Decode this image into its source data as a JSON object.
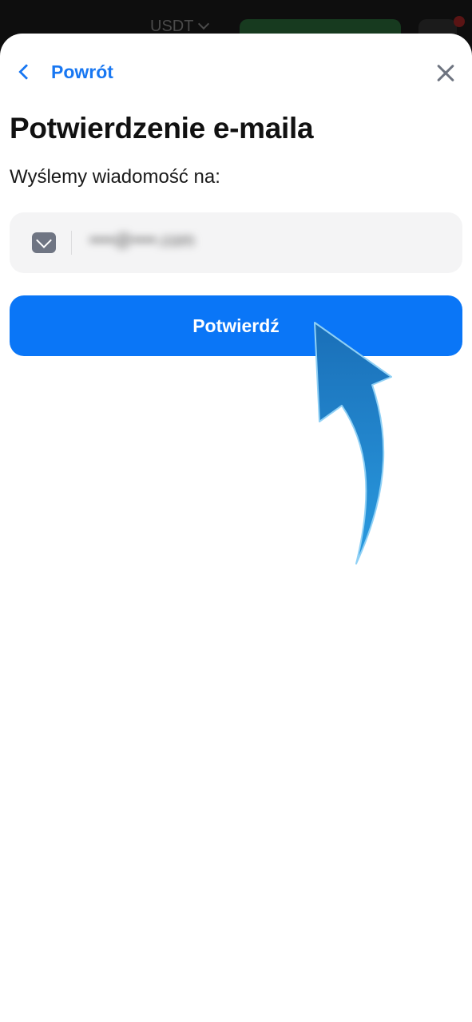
{
  "background_bar": {
    "logo": "",
    "currency": "USDT"
  },
  "sheet": {
    "back_label": "Powrót",
    "title": "Potwierdzenie e-maila",
    "subtitle": "Wyślemy wiadomość na:",
    "email_value": "••••@••••.com",
    "confirm_label": "Potwierdź"
  },
  "icons": {
    "back": "chevron-left-icon",
    "close": "close-icon",
    "mail": "mail-icon",
    "arrow": "arrow-pointer-annotation"
  },
  "colors": {
    "accent": "#0a76f7",
    "link": "#1877f2",
    "field_bg": "#f4f4f5",
    "arrow_fill": "#1e88d6"
  }
}
